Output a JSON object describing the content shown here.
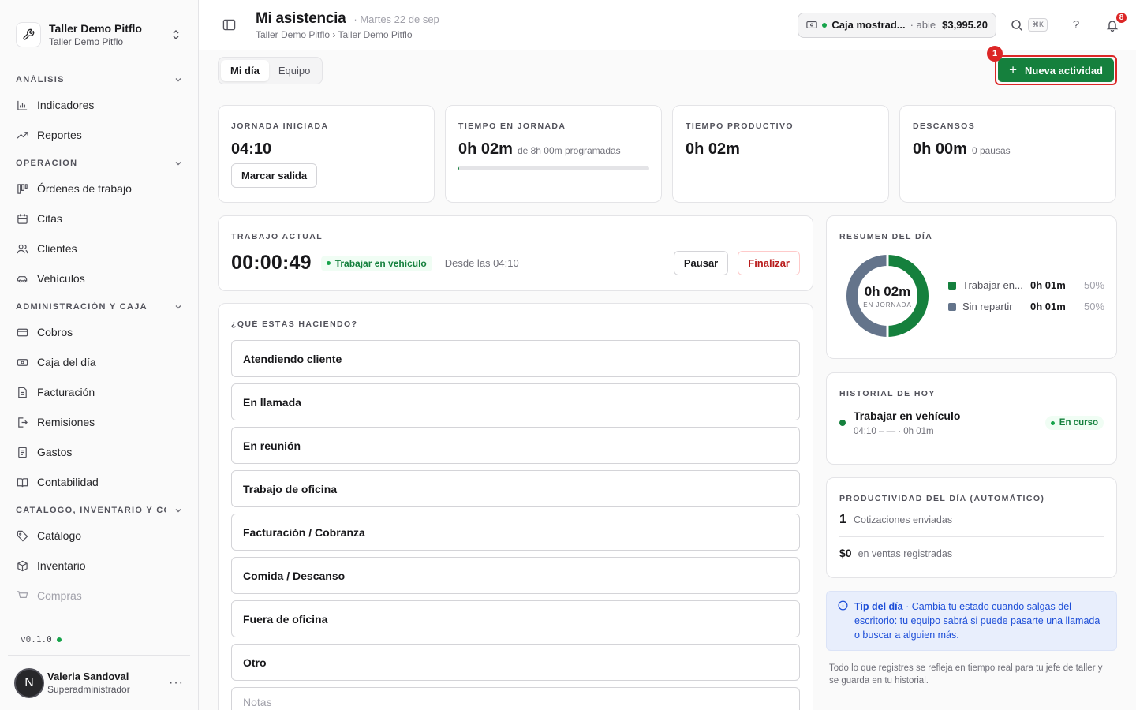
{
  "workspace": {
    "name": "Taller Demo Pitflo",
    "subtitle": "Taller Demo Pitflo"
  },
  "nav": {
    "sections": [
      {
        "label": "ANÁLISIS",
        "items": [
          {
            "label": "Indicadores",
            "icon": "bar-chart-icon"
          },
          {
            "label": "Reportes",
            "icon": "trend-icon"
          }
        ]
      },
      {
        "label": "OPERACIÓN",
        "items": [
          {
            "label": "Órdenes de trabajo",
            "icon": "kanban-icon"
          },
          {
            "label": "Citas",
            "icon": "calendar-icon"
          },
          {
            "label": "Clientes",
            "icon": "users-icon"
          },
          {
            "label": "Vehículos",
            "icon": "car-icon"
          }
        ]
      },
      {
        "label": "ADMINISTRACIÓN Y CAJA",
        "items": [
          {
            "label": "Cobros",
            "icon": "card-icon"
          },
          {
            "label": "Caja del día",
            "icon": "cash-icon"
          },
          {
            "label": "Facturación",
            "icon": "document-icon"
          },
          {
            "label": "Remisiones",
            "icon": "export-icon"
          },
          {
            "label": "Gastos",
            "icon": "receipt-icon"
          },
          {
            "label": "Contabilidad",
            "icon": "book-icon"
          }
        ]
      },
      {
        "label": "CATÁLOGO, INVENTARIO Y CO...",
        "items": [
          {
            "label": "Catálogo",
            "icon": "tag-icon"
          },
          {
            "label": "Inventario",
            "icon": "box-icon"
          },
          {
            "label": "Compras",
            "icon": "cart-icon"
          }
        ]
      }
    ]
  },
  "version": "v0.1.0",
  "user": {
    "initial": "N",
    "name": "Valeria Sandoval",
    "role": "Superadministrador"
  },
  "header": {
    "title": "Mi asistencia",
    "date": "· Martes 22 de sep",
    "breadcrumb": "Taller Demo Pitflo › Taller Demo Pitflo",
    "cash_name": "Caja mostrad...",
    "cash_state": "· abie",
    "cash_amount": "$3,995.20",
    "shortcut": "⌘K",
    "help": "?",
    "notifications": "8"
  },
  "tabs": {
    "mi_dia": "Mi día",
    "equipo": "Equipo"
  },
  "new_activity": {
    "label": "Nueva actividad",
    "step": "1"
  },
  "stats": {
    "jornada": {
      "label": "JORNADA INICIADA",
      "value": "04:10",
      "button": "Marcar salida"
    },
    "tiempo": {
      "label": "TIEMPO EN JORNADA",
      "value": "0h 02m",
      "note": "de 8h 00m programadas",
      "progress": 0.004
    },
    "productivo": {
      "label": "TIEMPO PRODUCTIVO",
      "value": "0h 02m"
    },
    "descansos": {
      "label": "DESCANSOS",
      "value": "0h 00m",
      "note": "0 pausas"
    }
  },
  "current": {
    "label": "TRABAJO ACTUAL",
    "timer": "00:00:49",
    "activity": "Trabajar en vehículo",
    "since": "Desde las 04:10",
    "pause": "Pausar",
    "finish": "Finalizar"
  },
  "doing": {
    "label": "¿QUÉ ESTÁS HACIENDO?",
    "options": [
      "Atendiendo cliente",
      "En llamada",
      "En reunión",
      "Trabajo de oficina",
      "Facturación / Cobranza",
      "Comida / Descanso",
      "Fuera de oficina",
      "Otro"
    ],
    "notes_placeholder": "Notas"
  },
  "summary": {
    "label": "RESUMEN DEL DÍA",
    "center_value": "0h 02m",
    "center_label": "EN JORNADA",
    "rows": [
      {
        "name": "Trabajar en...",
        "value": "0h 01m",
        "pct": "50%",
        "color": "#15803d",
        "share": 0.5
      },
      {
        "name": "Sin repartir",
        "value": "0h 01m",
        "pct": "50%",
        "color": "#64748b",
        "share": 0.5
      }
    ]
  },
  "history": {
    "label": "HISTORIAL DE HOY",
    "title": "Trabajar en vehículo",
    "sub": "04:10 – — · 0h 01m",
    "status": "En curso"
  },
  "productivity": {
    "label": "PRODUCTIVIDAD DEL DÍA (AUTOMÁTICO)",
    "quotes_num": "1",
    "quotes_text": "Cotizaciones enviadas",
    "sales_num": "$0",
    "sales_text": "en ventas registradas"
  },
  "tip": {
    "title": "Tip del día",
    "text": " · Cambia tu estado cuando salgas del escritorio: tu equipo sabrá si puede pasarte una llamada o buscar a alguien más."
  },
  "footer_note": "Todo lo que registres se refleja en tiempo real para tu jefe de taller y se guarda en tu historial.",
  "colors": {
    "accent": "#15803d",
    "danger": "#dc2626",
    "tip": "#1d4ed8"
  }
}
